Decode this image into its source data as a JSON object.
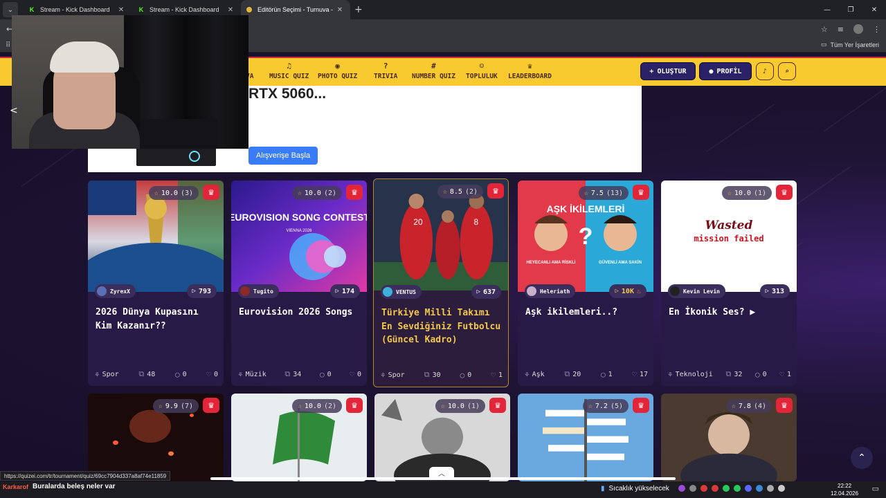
{
  "browser": {
    "tabs": [
      {
        "label": "Stream - Kick Dashboard",
        "active": false
      },
      {
        "label": "Stream - Kick Dashboard",
        "active": false
      },
      {
        "label": "Editörün Seçimi - Turnuva - Qu",
        "active": true
      }
    ],
    "bookmarks_all": "Tüm Yer İşaretleri"
  },
  "site_nav": {
    "items": [
      {
        "label": "VA",
        "icon": ""
      },
      {
        "label": "MUSIC QUIZ",
        "icon": "♫"
      },
      {
        "label": "PHOTO QUIZ",
        "icon": "◉"
      },
      {
        "label": "TRIVIA",
        "icon": "?"
      },
      {
        "label": "NUMBER QUIZ",
        "icon": "#"
      },
      {
        "label": "TOPLULUK",
        "icon": "☺"
      },
      {
        "label": "LEADERBOARD",
        "icon": "♛"
      }
    ],
    "create_label": "OLUŞTUR",
    "profile_label": "PROFİL"
  },
  "banner": {
    "title": "RTX 5060...",
    "button": "Alışverişe Başla"
  },
  "cards": [
    {
      "rating": "10.0",
      "count": "(3)",
      "author": "ZyrexX",
      "plays": "793",
      "title": "2026 Dünya Kupasını Kim Kazanır??",
      "category": "Spor",
      "questions": "48",
      "comments": "0",
      "likes": "0"
    },
    {
      "rating": "10.0",
      "count": "(2)",
      "author": "Tugito",
      "plays": "174",
      "title": "Eurovision 2026 Songs",
      "category": "Müzik",
      "questions": "34",
      "comments": "0",
      "likes": "0"
    },
    {
      "rating": "8.5",
      "count": "(2)",
      "author": "VENTUS",
      "plays": "637",
      "title": "Türkiye Milli Takımı En Sevdiğiniz Futbolcu (Güncel Kadro)",
      "category": "Spor",
      "questions": "30",
      "comments": "0",
      "likes": "1"
    },
    {
      "rating": "7.5",
      "count": "(13)",
      "author": "Heleriath",
      "plays": "10K",
      "title": "Aşk ikilemleri..?",
      "category": "Aşk",
      "questions": "20",
      "comments": "1",
      "likes": "17"
    },
    {
      "rating": "10.0",
      "count": "(1)",
      "author": "Kevin Levin",
      "plays": "313",
      "title": "En İkonik Ses? ▶",
      "category": "Teknoloji",
      "questions": "32",
      "comments": "0",
      "likes": "1"
    }
  ],
  "cards_row2": [
    {
      "rating": "9.9",
      "count": "(7)"
    },
    {
      "rating": "10.0",
      "count": "(2)"
    },
    {
      "rating": "10.0",
      "count": "(1)"
    },
    {
      "rating": "7.2",
      "count": "(5)"
    },
    {
      "rating": "7.8",
      "count": "(4)"
    }
  ],
  "thumb_text": {
    "eurovision": "EUROVISION SONG CONTEST",
    "eurovision_sub": "VIENNA 2026",
    "ask_title": "AŞK İKİLEMLERİ",
    "ask_left": "HEYECANLI AMA RİSKLİ",
    "ask_right": "GÜVENLİ AMA SAKİN",
    "wasted": "Wasted",
    "mission": "mission failed"
  },
  "status_url": "https://quizei.com/tr/tournament/quiz/69cc7904d337a8af74e11859",
  "taskbar": {
    "ticker_name": "Karkarof",
    "ticker_msg": "Buralarda beleş neler var",
    "weather": "Sıcaklık yükselecek",
    "time": "22:22",
    "date": "12.04.2026"
  },
  "colors": {
    "accent_yellow": "#f8ca2f",
    "brand_navy": "#2b2166",
    "crown_red": "#e3253a",
    "highlight_gold": "#f2c84b"
  }
}
